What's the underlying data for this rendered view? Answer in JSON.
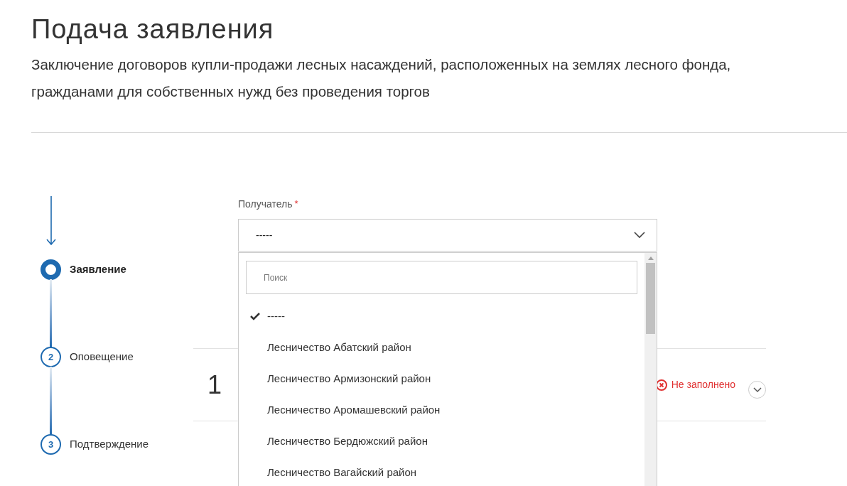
{
  "title": "Подача заявления",
  "subtitle": "Заключение договоров купли-продажи лесных насаждений, расположенных на землях лесного фонда, гражданами для собственных нужд без проведения торгов",
  "steps": [
    {
      "label": "Заявление",
      "selected": true
    },
    {
      "label": "Оповещение",
      "number": "2",
      "selected": false
    },
    {
      "label": "Подтверждение",
      "number": "3",
      "selected": false
    }
  ],
  "section": {
    "number": "1",
    "status": "Не заполнено"
  },
  "recipient": {
    "label": "Получатель",
    "required_mark": "*",
    "value": "-----",
    "expanded": true,
    "search_placeholder": "Поиск",
    "options": [
      {
        "label": "-----",
        "selected": true
      },
      {
        "label": "Лесничество Абатский район",
        "selected": false
      },
      {
        "label": "Лесничество Армизонский район",
        "selected": false
      },
      {
        "label": "Лесничество Аромашевский район",
        "selected": false
      },
      {
        "label": "Лесничество Бердюжский район",
        "selected": false
      },
      {
        "label": "Лесничество Вагайский район",
        "selected": false
      }
    ]
  }
}
